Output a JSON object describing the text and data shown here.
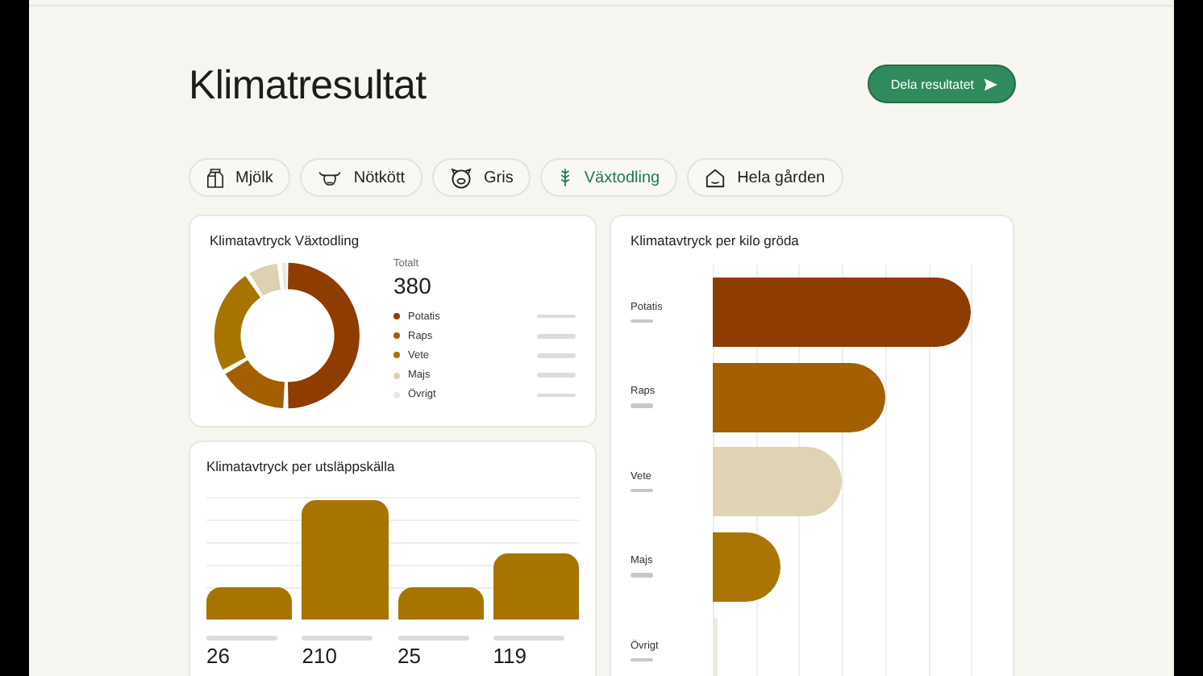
{
  "title": "Klimatresultat",
  "share_button": {
    "label": "Dela resultatet"
  },
  "tabs": [
    {
      "label": "Mjölk",
      "kind": "milk",
      "selected": false
    },
    {
      "label": "Nötkött",
      "kind": "cow",
      "selected": false
    },
    {
      "label": "Gris",
      "kind": "pig",
      "selected": false
    },
    {
      "label": "Växtodling",
      "kind": "grain",
      "selected": true
    },
    {
      "label": "Hela gården",
      "kind": "farm",
      "selected": false
    }
  ],
  "donut_card": {
    "title": "Klimatavtryck Växtodling",
    "total_label": "Totalt",
    "total": "380",
    "legend": [
      {
        "label": "Potatis",
        "color": "#8f3c00"
      },
      {
        "label": "Raps",
        "color": "#a35f00"
      },
      {
        "label": "Vete",
        "color": "#a87400"
      },
      {
        "label": "Majs",
        "color": "#ddd0b3"
      },
      {
        "label": "Övrigt",
        "color": "#ece7dc"
      }
    ]
  },
  "source_card": {
    "title": "Klimatavtryck per utsläppskälla",
    "values": [
      "26",
      "210",
      "25",
      "119"
    ]
  },
  "crop_card": {
    "title": "Klimatavtryck per kilo gröda",
    "rows": [
      {
        "label": "Potatis",
        "color": "#8f3c00"
      },
      {
        "label": "Raps",
        "color": "#a35f00"
      },
      {
        "label": "Vete",
        "color": "#e0d3b5"
      },
      {
        "label": "Majs",
        "color": "#ab7505"
      },
      {
        "label": "Övrigt",
        "color": "#efeadf"
      }
    ]
  }
}
